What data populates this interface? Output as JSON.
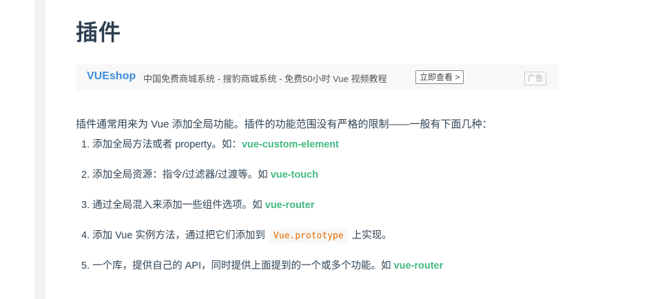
{
  "page_title": "插件",
  "ad": {
    "brand": "VUEshop",
    "text": "中国免费商城系统 - 搜豹商城系统 - 免费50小时 Vue 视频教程",
    "button": "立即查看 >",
    "tag": "广告"
  },
  "intro": "插件通常用来为 Vue 添加全局功能。插件的功能范围没有严格的限制——一般有下面几种：",
  "items": [
    {
      "num": "1.",
      "text": "添加全局方法或者 property。如：",
      "link": "vue-custom-element"
    },
    {
      "num": "2.",
      "text": "添加全局资源：指令/过滤器/过渡等。如 ",
      "link": "vue-touch"
    },
    {
      "num": "3.",
      "text": "通过全局混入来添加一些组件选项。如 ",
      "link": "vue-router"
    },
    {
      "num": "4.",
      "text": "添加 Vue 实例方法，通过把它们添加到",
      "code": "Vue.prototype",
      "text_after": "上实现。"
    },
    {
      "num": "5.",
      "text": "一个库，提供自己的 API，同时提供上面提到的一个或多个功能。如 ",
      "link": "vue-router"
    }
  ],
  "colors": {
    "link": "#42b983",
    "code": "#e96900",
    "brand": "#3c8ede",
    "heading": "#2c3e50"
  }
}
